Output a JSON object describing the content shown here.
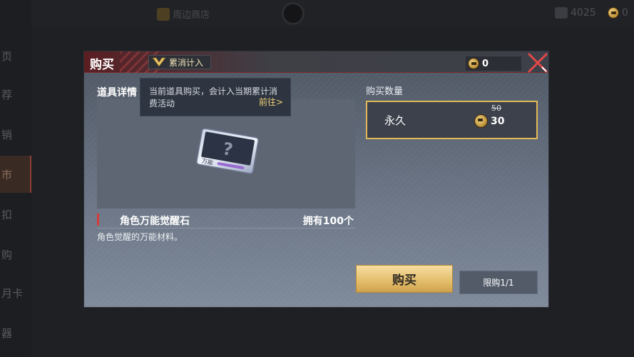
{
  "background": {
    "nav_items": [
      "页",
      "荐",
      "销",
      "市",
      "扣",
      "购",
      "月卡",
      "器"
    ],
    "shop_label": "周边商店",
    "currency_a": "4025",
    "currency_b": "0"
  },
  "modal": {
    "title": "购买",
    "tag_label": "累消计入",
    "balance": "0",
    "detail_label": "道具详情",
    "tooltip": {
      "text": "当前道具购买，会计入当期累计消费活动",
      "goto": "前往>"
    },
    "item": {
      "name": "角色万能觉醒石",
      "owned": "拥有100个",
      "description": "角色觉醒的万能材料。",
      "card_label": "万能"
    },
    "quantity_label": "购买数量",
    "option": {
      "name": "永久",
      "old_price": "50",
      "price": "30"
    },
    "buy_button": "购买",
    "limit_button": "限购1/1"
  },
  "colors": {
    "accent_gold": "#e2b858",
    "danger_red": "#d63b3b"
  }
}
